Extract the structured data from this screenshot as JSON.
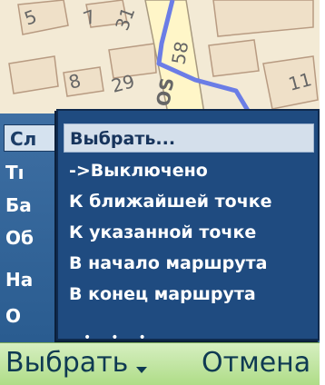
{
  "map": {
    "house_numbers": [
      "5",
      "7",
      "31",
      "58",
      "8",
      "29",
      "11"
    ],
    "street_label": "OS"
  },
  "background_list": {
    "row_labels": [
      "Сл",
      "Тı",
      "Бa",
      "Об",
      "На",
      "О"
    ]
  },
  "popup_menu": {
    "items": [
      {
        "label": "Выбрать...",
        "highlighted": true
      },
      {
        "label": "->Выключено",
        "highlighted": false
      },
      {
        "label": "К ближайшей точке",
        "highlighted": false
      },
      {
        "label": "К указанной точке",
        "highlighted": false
      },
      {
        "label": "В начало маршрута",
        "highlighted": false
      },
      {
        "label": "В конец маршрута",
        "highlighted": false
      }
    ],
    "more_indicator": "•••"
  },
  "softkeys": {
    "left_label": "Выбрать",
    "right_label": "Отмена"
  },
  "colors": {
    "menu_bg": "#1f4b80",
    "highlight": "#d4dfeb",
    "softkey_bar": "#aedc86",
    "route": "#6b7de6"
  }
}
